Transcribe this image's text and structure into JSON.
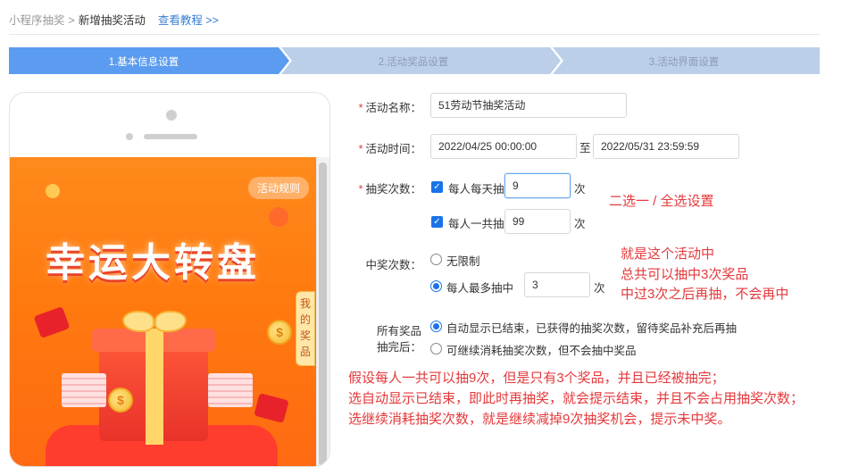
{
  "breadcrumb": {
    "root": "小程序抽奖",
    "separator": ">",
    "current": "新增抽奖活动",
    "tutorial_link": "查看教程 >>"
  },
  "steps": [
    {
      "label": "1.基本信息设置",
      "active": true
    },
    {
      "label": "2.活动奖品设置",
      "active": false
    },
    {
      "label": "3.活动界面设置",
      "active": false
    }
  ],
  "colors": {
    "step_active": "#5b9cf0",
    "step_inactive": "#bccfe9",
    "required": "#e4393c",
    "annotation": "#e4393c",
    "accent": "#1a73e8"
  },
  "preview": {
    "rules_button": "活动规则",
    "title": "幸运大转盘",
    "my_prize_tab": "我的奖品",
    "coin_symbol": "$"
  },
  "form": {
    "name": {
      "label": "活动名称：",
      "value": "51劳动节抽奖活动"
    },
    "time": {
      "label": "活动时间：",
      "start": "2022/04/25 00:00:00",
      "to": "至",
      "end": "2022/05/31 23:59:59"
    },
    "draw_count": {
      "label": "抽奖次数：",
      "daily": {
        "label": "每人每天抽",
        "value": "9",
        "unit": "次",
        "checked": true
      },
      "total": {
        "label": "每人一共抽",
        "value": "99",
        "unit": "次",
        "checked": true
      }
    },
    "win_count": {
      "label": "中奖次数：",
      "unlimited": {
        "label": "无限制",
        "selected": false
      },
      "max": {
        "label": "每人最多抽中",
        "value": "3",
        "unit": "次",
        "selected": true
      }
    },
    "after_drawn": {
      "label_line1": "所有奖品",
      "label_line2": "抽完后：",
      "option_auto": {
        "label": "自动显示已结束，已获得的抽奖次数，留待奖品补充后再抽",
        "selected": true
      },
      "option_continue": {
        "label": "可继续消耗抽奖次数，但不会抽中奖品",
        "selected": false
      }
    }
  },
  "annotations": {
    "choice": "二选一 / 全选设置",
    "win_lines": [
      "就是这个活动中",
      "总共可以抽中3次奖品",
      "中过3次之后再抽，不会再中"
    ],
    "bottom_lines": [
      "假设每人一共可以抽9次，但是只有3个奖品，并且已经被抽完；",
      "选自动显示已结束，即此时再抽奖，就会提示结束，并且不会占用抽奖次数；",
      "选继续消耗抽奖次数，就是继续减掉9次抽奖机会，提示未中奖。"
    ]
  }
}
